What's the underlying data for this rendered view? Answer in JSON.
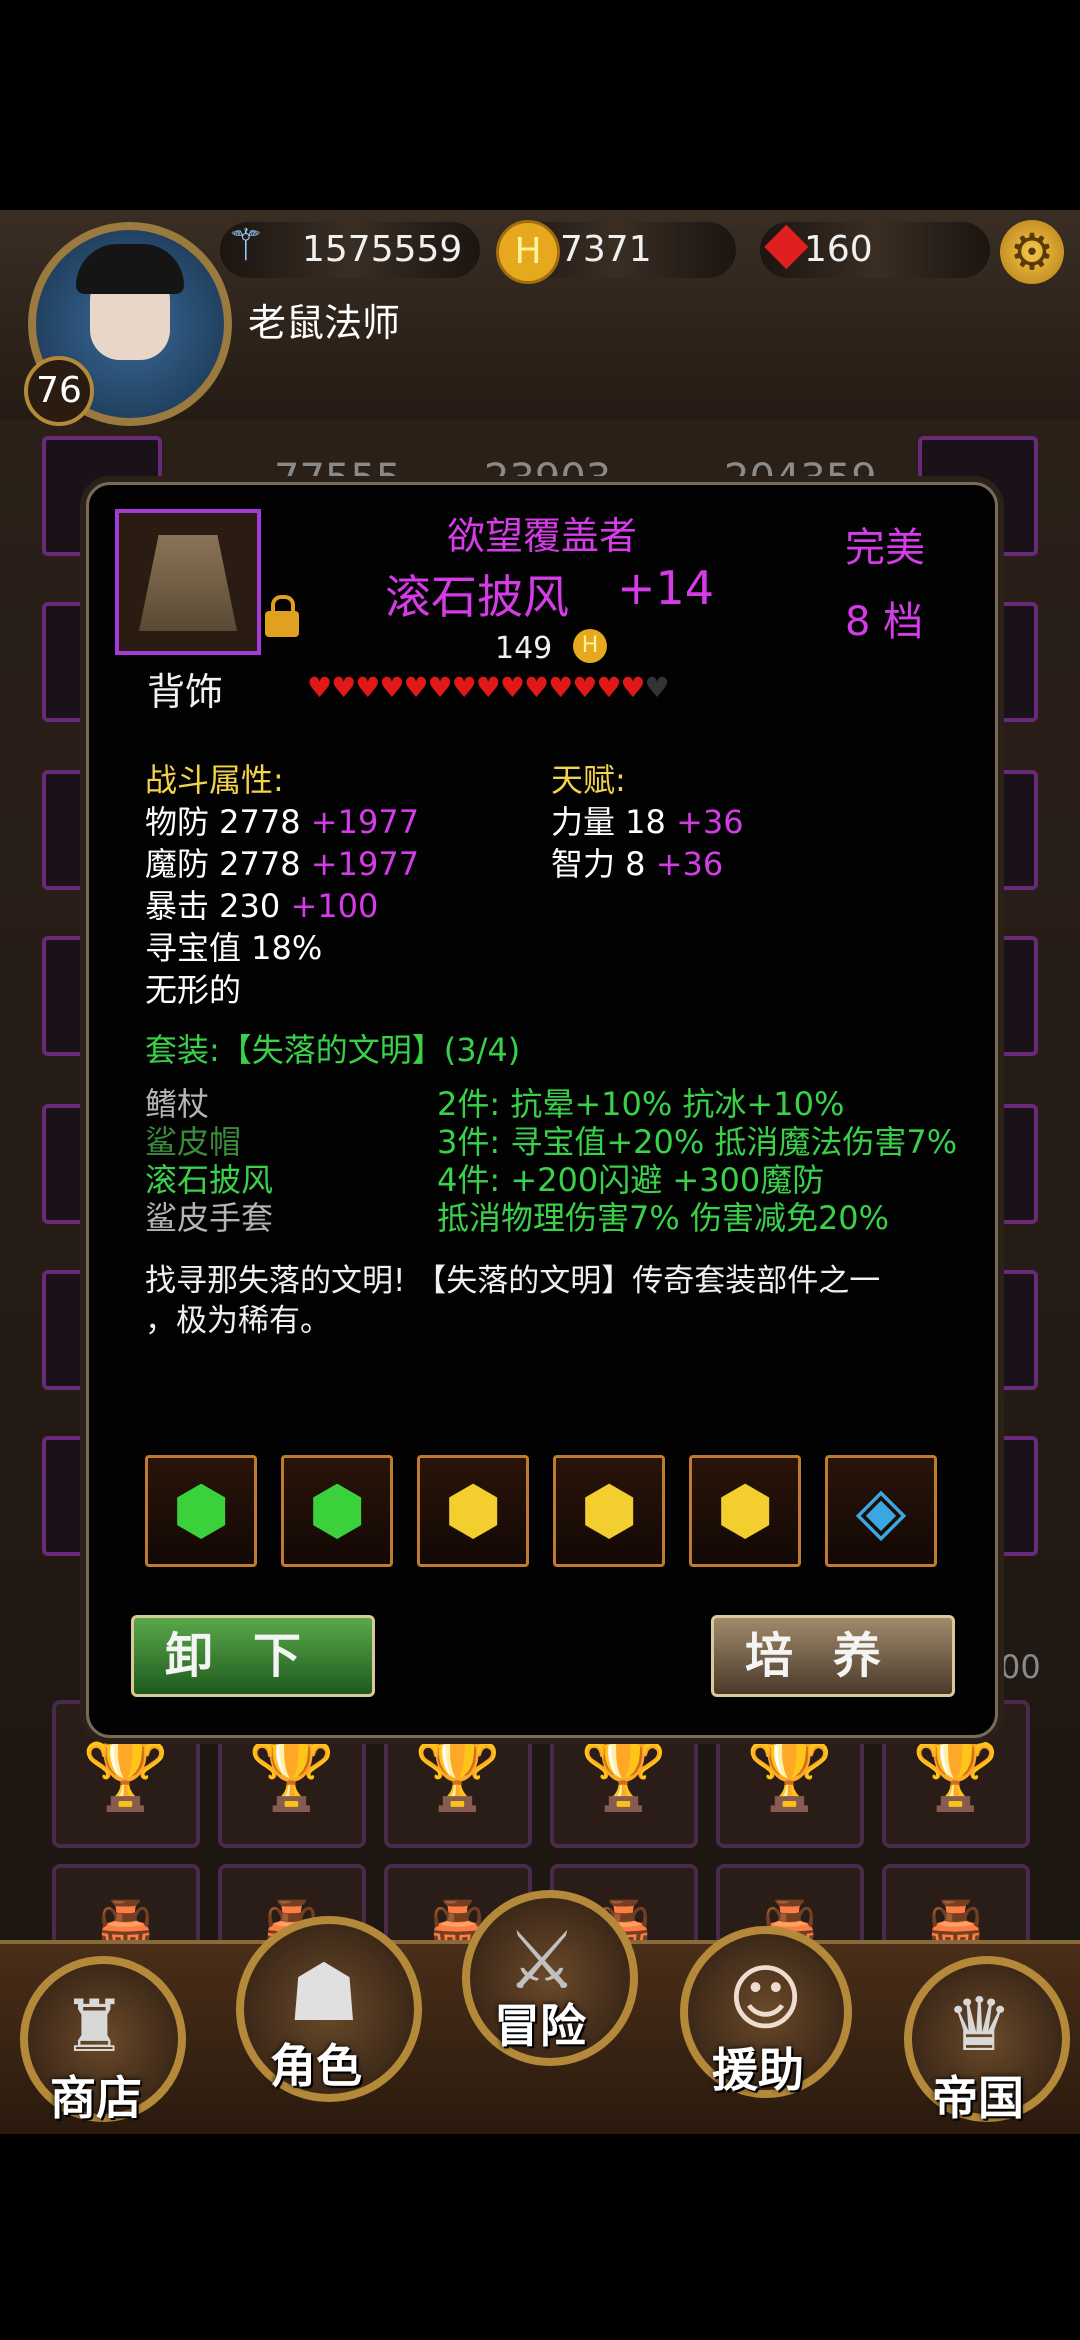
{
  "header": {
    "power": "1575559",
    "gold": "7371",
    "gems": "160",
    "player_name": "老鼠法师",
    "level": "76"
  },
  "stats_partial": [
    "77555",
    "23903",
    "204359"
  ],
  "bottom_stat_partial": "00",
  "item": {
    "set_name": "欲望覆盖者",
    "name": "滚石披风",
    "enhance": "+14",
    "quality": "完美",
    "tier": "8  档",
    "price": "149",
    "slot": "背饰",
    "hearts_filled": 14,
    "hearts_total": 15
  },
  "combat": {
    "title": "战斗属性:",
    "rows": [
      {
        "label": "物防 2778",
        "bonus": "+1977"
      },
      {
        "label": "魔防 2778",
        "bonus": "+1977"
      },
      {
        "label": "暴击 230",
        "bonus": "+100"
      },
      {
        "label": "寻宝值 18%",
        "bonus": ""
      },
      {
        "label": "无形的",
        "bonus": ""
      }
    ]
  },
  "talent": {
    "title": "天赋:",
    "rows": [
      {
        "label": "力量 18",
        "bonus": "+36"
      },
      {
        "label": "智力 8",
        "bonus": "+36"
      }
    ]
  },
  "set": {
    "title": "套装:【失落的文明】(3/4)",
    "pieces": [
      {
        "name": "鳍杖",
        "owned": false
      },
      {
        "name": "鲨皮帽",
        "owned": true
      },
      {
        "name": "滚石披风",
        "owned": true
      },
      {
        "name": "鲨皮手套",
        "owned": false
      }
    ],
    "bonuses": [
      "2件:  抗晕+10% 抗冰+10%",
      "3件:  寻宝值+20% 抵消魔法伤害7%",
      "4件:  +200闪避 +300魔防",
      "抵消物理伤害7% 伤害减免20%"
    ]
  },
  "description_line1": "找寻那失落的文明!  【失落的文明】传奇套装部件之一",
  "description_line2": "，极为稀有。",
  "gems": [
    {
      "icon": "green-gem-icon",
      "color": "#3bd13b"
    },
    {
      "icon": "green-gem-icon",
      "color": "#3bd13b"
    },
    {
      "icon": "yellow-gem-icon",
      "color": "#f2cf2e"
    },
    {
      "icon": "yellow-gem-icon",
      "color": "#f2cf2e"
    },
    {
      "icon": "yellow-gem-icon",
      "color": "#f2cf2e"
    },
    {
      "icon": "blue-gem-icon",
      "color": "#3aa7e0"
    }
  ],
  "buttons": {
    "unequip": "卸下",
    "cultivate": "培养"
  },
  "nav": [
    "商店",
    "角色",
    "冒险",
    "援助",
    "帝国"
  ]
}
